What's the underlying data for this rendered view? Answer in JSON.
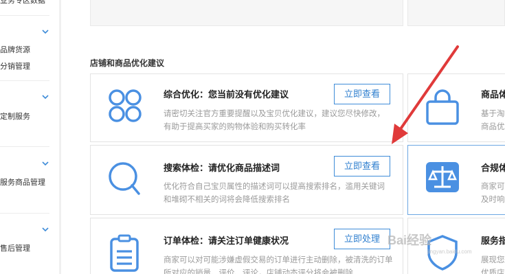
{
  "sidebar": {
    "top_cut_text": "业务专区数据",
    "groups": [
      {
        "items": [
          "品牌货源",
          "分销管理"
        ]
      },
      {
        "items": [
          "定制服务"
        ]
      },
      {
        "items": [
          "服务商品管理"
        ]
      },
      {
        "items": [
          "售后管理"
        ]
      }
    ]
  },
  "main": {
    "section_title": "店铺和商品优化建议",
    "cards": [
      {
        "icon": "four-circles-icon",
        "title": "综合优化：您当前没有优化建议",
        "desc": "请密切关注官方重要提醒以及宝贝优化建议，建议您尽快修改，有助于提高买家的购物体验和购买转化率",
        "button": "立即查看"
      },
      {
        "icon": "magnifier-icon",
        "title": "搜索体检：请优化商品描述词",
        "desc": "优化符合自己宝贝属性的描述词可以提高搜索排名，滥用关键词和堆砌不相关的词将会降低搜索排名",
        "button": "立即查看"
      },
      {
        "icon": "clipboard-icon",
        "title": "订单体检：请关注订单健康状况",
        "desc": "商家可以对可能涉嫌虚假交易的订单进行主动删除，被清洗的订单所对应的销量、评价、评论，店铺动态评分将会被删除",
        "button": "立即处理"
      }
    ],
    "right_cards": [
      {
        "icon": "shopping-bag-icon",
        "title": "商品体",
        "desc_lines": [
          "基于淘",
          "商品优"
        ]
      },
      {
        "icon": "scales-icon",
        "title": "合规体",
        "desc_lines": [
          "商家可",
          "及时响"
        ]
      },
      {
        "icon": "shield-icon",
        "title": "服务指",
        "desc_lines": [
          "展现您",
          "优质店"
        ]
      }
    ]
  },
  "watermark": {
    "text": "Bai经验",
    "sub": "jingyan.baidu.com"
  },
  "colors": {
    "accent": "#3d8bd8",
    "icon_blue": "#4a90e2",
    "arrow_red": "#e03a3a"
  }
}
